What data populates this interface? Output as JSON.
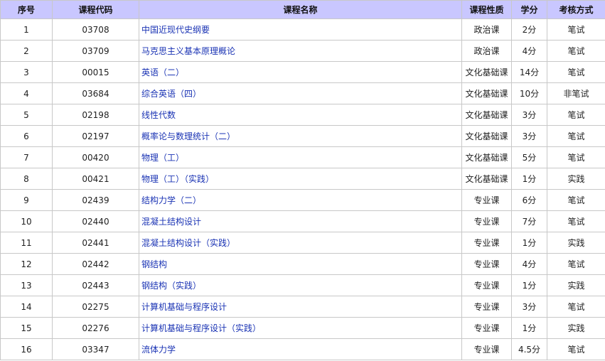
{
  "headers": {
    "seq": "序号",
    "code": "课程代码",
    "name": "课程名称",
    "type": "课程性质",
    "credit": "学分",
    "exam": "考核方式"
  },
  "rows": [
    {
      "seq": "1",
      "code": "03708",
      "name": "中国近现代史纲要",
      "type": "政治课",
      "credit": "2分",
      "exam": "笔试"
    },
    {
      "seq": "2",
      "code": "03709",
      "name": "马克思主义基本原理概论",
      "type": "政治课",
      "credit": "4分",
      "exam": "笔试"
    },
    {
      "seq": "3",
      "code": "00015",
      "name": "英语（二）",
      "type": "文化基础课",
      "credit": "14分",
      "exam": "笔试"
    },
    {
      "seq": "4",
      "code": "03684",
      "name": "综合英语（四）",
      "type": "文化基础课",
      "credit": "10分",
      "exam": "非笔试"
    },
    {
      "seq": "5",
      "code": "02198",
      "name": "线性代数",
      "type": "文化基础课",
      "credit": "3分",
      "exam": "笔试"
    },
    {
      "seq": "6",
      "code": "02197",
      "name": "概率论与数理统计（二）",
      "type": "文化基础课",
      "credit": "3分",
      "exam": "笔试"
    },
    {
      "seq": "7",
      "code": "00420",
      "name": "物理（工）",
      "type": "文化基础课",
      "credit": "5分",
      "exam": "笔试"
    },
    {
      "seq": "8",
      "code": "00421",
      "name": "物理（工）（实践）",
      "type": "文化基础课",
      "credit": "1分",
      "exam": "实践"
    },
    {
      "seq": "9",
      "code": "02439",
      "name": "结构力学（二）",
      "type": "专业课",
      "credit": "6分",
      "exam": "笔试"
    },
    {
      "seq": "10",
      "code": "02440",
      "name": "混凝土结构设计",
      "type": "专业课",
      "credit": "7分",
      "exam": "笔试"
    },
    {
      "seq": "11",
      "code": "02441",
      "name": "混凝土结构设计（实践）",
      "type": "专业课",
      "credit": "1分",
      "exam": "实践"
    },
    {
      "seq": "12",
      "code": "02442",
      "name": "钢结构",
      "type": "专业课",
      "credit": "4分",
      "exam": "笔试"
    },
    {
      "seq": "13",
      "code": "02443",
      "name": "钢结构（实践）",
      "type": "专业课",
      "credit": "1分",
      "exam": "实践"
    },
    {
      "seq": "14",
      "code": "02275",
      "name": "计算机基础与程序设计",
      "type": "专业课",
      "credit": "3分",
      "exam": "笔试"
    },
    {
      "seq": "15",
      "code": "02276",
      "name": "计算机基础与程序设计（实践）",
      "type": "专业课",
      "credit": "1分",
      "exam": "实践"
    },
    {
      "seq": "16",
      "code": "03347",
      "name": "流体力学",
      "type": "专业课",
      "credit": "4.5分",
      "exam": "笔试"
    }
  ]
}
